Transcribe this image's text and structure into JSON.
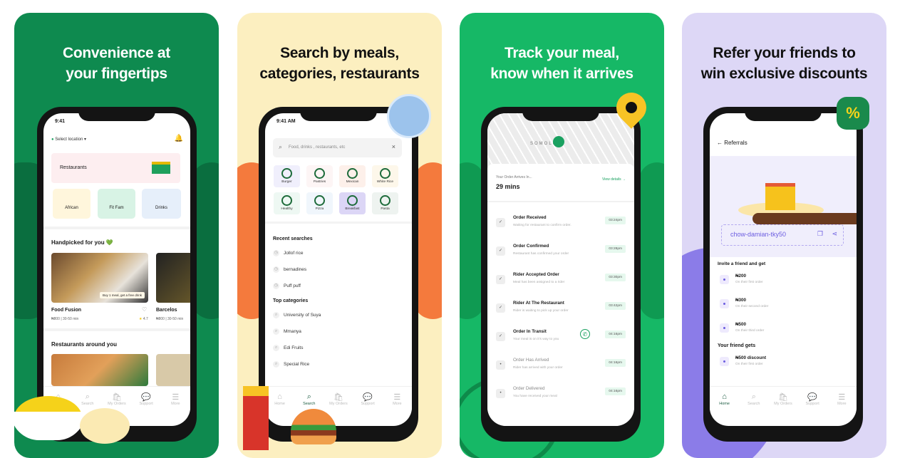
{
  "colors": {
    "panel1": "#0e8a4f",
    "panel2": "#fcefc0",
    "panel3": "#16b866",
    "panel4": "#ddd7f6",
    "accent": "#1c5c42",
    "referral": "#6b5ce0"
  },
  "panel1": {
    "headline1": "Convenience at",
    "headline2": "your fingertips",
    "time": "9:41",
    "location": "Select location",
    "banner": "Restaurants",
    "tiles": [
      "African",
      "Fit Fam",
      "Drinks"
    ],
    "handpicked": "Handpicked for you 💚",
    "promo": "Buy 1 meal, get a free drink",
    "cards": [
      {
        "name": "Food Fusion",
        "price": "₦800",
        "eta": "30-50 min",
        "rating": "4.7"
      },
      {
        "name": "Barcelos",
        "price": "₦800",
        "eta": "30-50 min"
      }
    ],
    "around": "Restaurants around you"
  },
  "nav": {
    "home": "Home",
    "search": "Search",
    "orders": "My Orders",
    "support": "Support",
    "more": "More"
  },
  "panel2": {
    "headline1": "Search by meals,",
    "headline2": "categories, restaurants",
    "time": "9:41 AM",
    "search_placeholder": "Food, drinks , restaurants, etc",
    "categories": [
      "Burger",
      "Pastries",
      "Mexican",
      "White Rice",
      "Healthy",
      "Pizza",
      "Breakfast",
      "Pasta"
    ],
    "recent_title": "Recent searches",
    "recent": [
      "Jollof rice",
      "bernadines",
      "Puff puff"
    ],
    "top_title": "Top categories",
    "top": [
      "University of Suya",
      "Mmanya",
      "Edi Fruits",
      "Special Rice"
    ]
  },
  "panel3": {
    "headline1": "Track your meal,",
    "headline2": "know when it arrives",
    "map_label": "SOMOLU",
    "arrives_label": "Your Order Arrives In...",
    "eta": "29 mins",
    "view_details": "View details →",
    "steps": [
      {
        "title": "Order Received",
        "sub": "Waiting for restaurant to confirm order.",
        "time": "03:24pm",
        "done": true
      },
      {
        "title": "Order Confirmed",
        "sub": "Restaurant has confirmed your order",
        "time": "03:28pm",
        "done": true
      },
      {
        "title": "Rider Accepted Order",
        "sub": "Meal has been assigned to a rider",
        "time": "03:30pm",
        "done": true
      },
      {
        "title": "Rider At The Restaurant",
        "sub": "Rider is waiting to pick up your order",
        "time": "03:42pm",
        "done": true
      },
      {
        "title": "Order In Transit",
        "sub": "Your meal is on it's way to you",
        "time": "04:16pm",
        "done": true
      },
      {
        "title": "Order Has Arrived",
        "sub": "Rider has arrived with your order",
        "time": "04:16pm",
        "done": false
      },
      {
        "title": "Order Delivered",
        "sub": "You have received your meal",
        "time": "04:16pm",
        "done": false
      }
    ]
  },
  "panel4": {
    "headline1": "Refer your friends to",
    "headline2": "win exclusive discounts",
    "badge": "%",
    "title": "Referrals",
    "code": "chow-damian-tky50",
    "invite_title": "Invite a friend and get",
    "rewards": [
      {
        "amount": "₦200",
        "sub": "On their first order"
      },
      {
        "amount": "₦300",
        "sub": "On their second order"
      },
      {
        "amount": "₦500",
        "sub": "On their third order"
      }
    ],
    "friend_title": "Your friend gets",
    "friend": {
      "amount": "₦500 discount",
      "sub": "On their first order"
    }
  }
}
